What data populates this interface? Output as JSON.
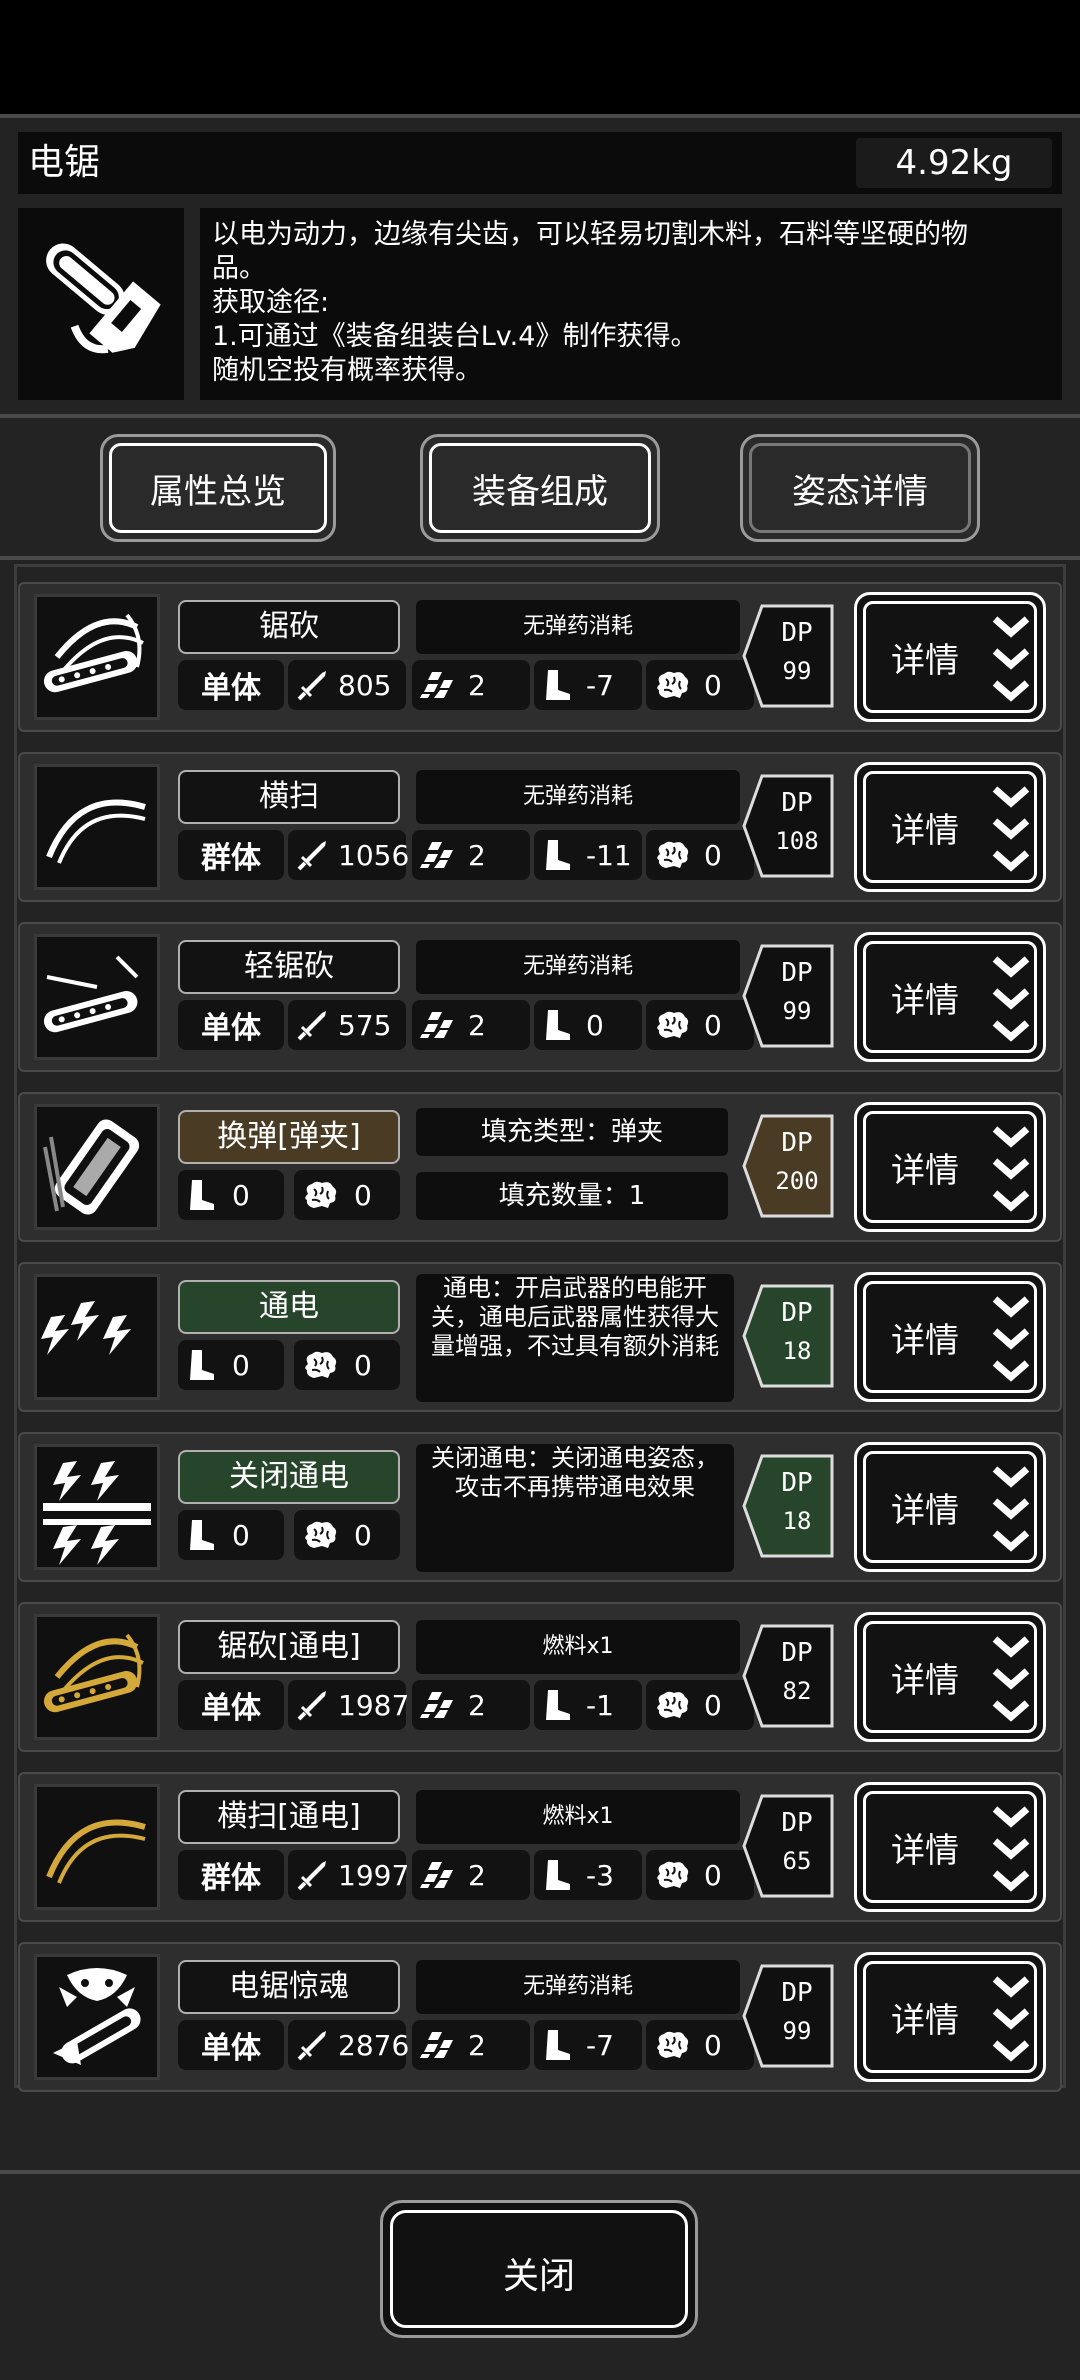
{
  "item": {
    "name": "电锯",
    "weight": "4.92kg",
    "icon": "chainsaw-icon",
    "description": [
      "以电为动力，边缘有尖齿，可以轻易切割木料，石料等坚硬的物",
      "品。",
      "获取途径:",
      "1.可通过《装备组装台Lv.4》制作获得。",
      "随机空投有概率获得。"
    ]
  },
  "tabs": [
    "属性总览",
    "装备组成",
    "姿态详情"
  ],
  "active_tab": 2,
  "detail_label": "详情",
  "skills": [
    {
      "name": "锯砍",
      "style": "plain",
      "cost": "无弹药消耗",
      "type": "单体",
      "atk": "805",
      "spd": "2",
      "move": "-7",
      "mind": "0",
      "dp": "99",
      "dp_style": "black",
      "icon": "chainsaw-slash-icon"
    },
    {
      "name": "横扫",
      "style": "plain",
      "cost": "无弹药消耗",
      "type": "群体",
      "atk": "1056",
      "spd": "2",
      "move": "-11",
      "mind": "0",
      "dp": "108",
      "dp_style": "black",
      "icon": "sweep-icon"
    },
    {
      "name": "轻锯砍",
      "style": "plain",
      "cost": "无弹药消耗",
      "type": "单体",
      "atk": "575",
      "spd": "2",
      "move": "0",
      "mind": "0",
      "dp": "99",
      "dp_style": "black",
      "icon": "light-saw-icon"
    },
    {
      "name": "换弹[弹夹]",
      "style": "brown",
      "fill_type": "填充类型：弹夹",
      "fill_count": "填充数量：1",
      "move": "0",
      "mind": "0",
      "dp": "200",
      "dp_style": "brown",
      "icon": "reload-magazine-icon"
    },
    {
      "name": "通电",
      "style": "green",
      "desc": "通电：开启武器的电能开关，通电后武器属性获得大量增强，不过具有额外消耗",
      "move": "0",
      "mind": "0",
      "dp": "18",
      "dp_style": "green",
      "icon": "power-on-icon"
    },
    {
      "name": "关闭通电",
      "style": "green",
      "desc": "关闭通电：关闭通电姿态，攻击不再携带通电效果",
      "move": "0",
      "mind": "0",
      "dp": "18",
      "dp_style": "green",
      "icon": "power-off-icon"
    },
    {
      "name": "锯砍[通电]",
      "style": "plain",
      "cost": "燃料x1",
      "type": "单体",
      "atk": "1987",
      "spd": "2",
      "move": "-1",
      "mind": "0",
      "dp": "82",
      "dp_style": "black",
      "icon": "powered-chainsaw-slash-icon"
    },
    {
      "name": "横扫[通电]",
      "style": "plain",
      "cost": "燃料x1",
      "type": "群体",
      "atk": "1997",
      "spd": "2",
      "move": "-3",
      "mind": "0",
      "dp": "65",
      "dp_style": "black",
      "icon": "powered-sweep-icon"
    },
    {
      "name": "电锯惊魂",
      "style": "plain",
      "cost": "无弹药消耗",
      "type": "单体",
      "atk": "2876",
      "spd": "2",
      "move": "-7",
      "mind": "0",
      "dp": "99",
      "dp_style": "black",
      "icon": "chainsaw-terror-icon"
    }
  ],
  "dp_label": "DP",
  "close_label": "关闭",
  "colors": {
    "gold": "#d4a93a",
    "green": "#27452b",
    "brown": "#4a3c24"
  }
}
